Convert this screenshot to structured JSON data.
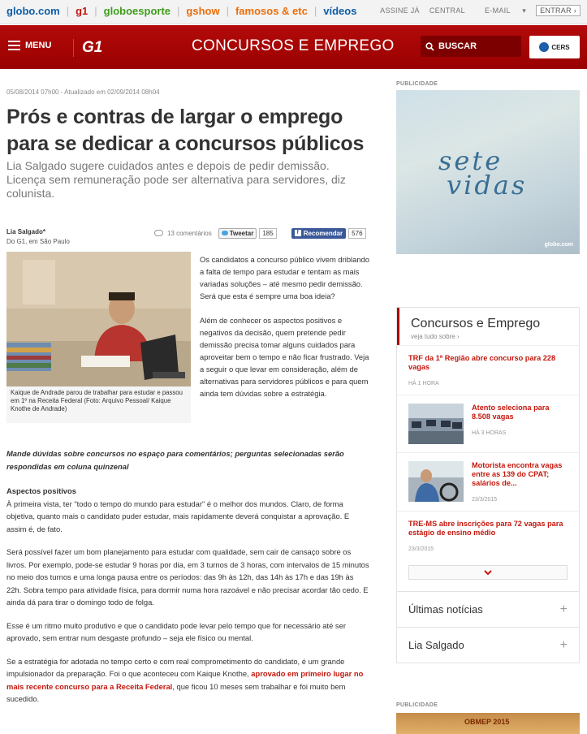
{
  "globalbar": {
    "brands": [
      "globo.com",
      "g1",
      "globoesporte",
      "gshow",
      "famosos & etc",
      "vídeos"
    ],
    "links": [
      "ASSINE JÁ",
      "CENTRAL",
      "E-MAIL"
    ],
    "enter_label": "ENTRAR ›"
  },
  "header": {
    "menu_label": "MENU",
    "logo": "G1",
    "section_title": "CONCURSOS E EMPREGO",
    "search_label": "BUSCAR",
    "partner_logo": "CERS"
  },
  "article": {
    "dateline": "05/08/2014 07h00 - Atualizado em 02/09/2014 08h04",
    "title": "Prós e contras de largar o emprego para se dedicar a concursos públicos",
    "subtitle": "Lia Salgado sugere cuidados antes e depois de pedir demissão. Licença sem remuneração pode ser alternativa para servidores, diz colunista.",
    "author": "Lia Salgado*",
    "author_source": "Do G1, em São Paulo",
    "comments": "13 comentários",
    "tweet_label": "Tweetar",
    "tweet_count": "185",
    "fb_label": "Recomendar",
    "fb_count": "576",
    "photo_caption": "Kaique de Andrade parou de trabalhar para estudar e passou em 1º na Receita Federal (Foto: Arquivo Pessoal/ Kaique Knothe de Andrade)",
    "intro_p1": "Os candidatos a concurso público vivem driblando a falta de tempo para estudar e tentam as mais variadas soluções – até mesmo pedir demissão. Será que esta é sempre uma boa ideia?",
    "intro_p2": "Além de conhecer os aspectos positivos e negativos da decisão, quem pretende pedir demissão precisa tomar alguns cuidados para aproveitar bem o tempo e não ficar frustrado. Veja a seguir o que levar em consideração, além de alternativas para servidores públicos e para quem ainda tem dúvidas sobre a estratégia.",
    "lead": "Mande dúvidas sobre concursos no espaço para comentários; perguntas selecionadas serão respondidas em coluna quinzenal",
    "subhead": "Aspectos positivos",
    "p1": "À primeira vista, ter \"todo o tempo do mundo para estudar\" é o melhor dos mundos. Claro, de forma objetiva, quanto mais o candidato puder estudar, mais rapidamente deverá conquistar a aprovação. E assim é, de fato.",
    "p2": "Será possível fazer um bom planejamento para estudar com qualidade, sem cair de cansaço sobre os livros. Por exemplo, pode-se estudar 9 horas por dia, em 3 turnos de 3 horas, com intervalos de 15 minutos no meio dos turnos e uma longa pausa entre os períodos: das 9h às 12h, das 14h às 17h e das 19h às 22h. Sobra tempo para atividade física, para dormir numa hora razoável e não precisar acordar tão cedo. E ainda dá para tirar o domingo todo de folga.",
    "p3": "Esse é um ritmo muito produtivo e que o candidato pode levar pelo tempo que for necessário até ser aprovado, sem entrar num desgaste profundo – seja ele físico ou mental.",
    "p4_start": "Se a estratégia for adotada no tempo certo e com real comprometimento do candidato, é um grande impulsionador da preparação. Foi o que aconteceu com Kaique Knothe,",
    "p4_link": "aprovado em primeiro lugar no mais recente concurso para a Receita Federal",
    "p4_end": ", que ficou 10 meses sem trabalhar e foi muito bem sucedido."
  },
  "sidebar": {
    "pub_label": "PUBLICIDADE",
    "ad_text_1": "sete",
    "ad_text_2": "vidas",
    "ad_brand": "globo.com",
    "box_title": "Concursos e Emprego",
    "box_more": "veja tudo sobre ›",
    "news": [
      {
        "headline": "TRF da 1ª Região abre concurso para 228 vagas",
        "time": "HÁ 1 HORA"
      },
      {
        "headline": "Atento seleciona para 8.508 vagas",
        "time": "HÁ 3 HORAS"
      },
      {
        "headline": "Motorista encontra vagas entre as 139 do CPAT; salários de...",
        "time": "23/3/2015"
      },
      {
        "headline": "TRE-MS abre inscrições para 72 vagas para estágio de ensino médio",
        "time": "23/3/2015"
      }
    ],
    "acc_1": "Últimas notícias",
    "acc_2": "Lia Salgado",
    "bottom_pub_label": "PUBLICIDADE",
    "bottom_ad_text": "OBMEP 2015"
  },
  "colors": {
    "brand_red": "#a80000",
    "link_red": "#c4170c",
    "text": "#333333"
  }
}
